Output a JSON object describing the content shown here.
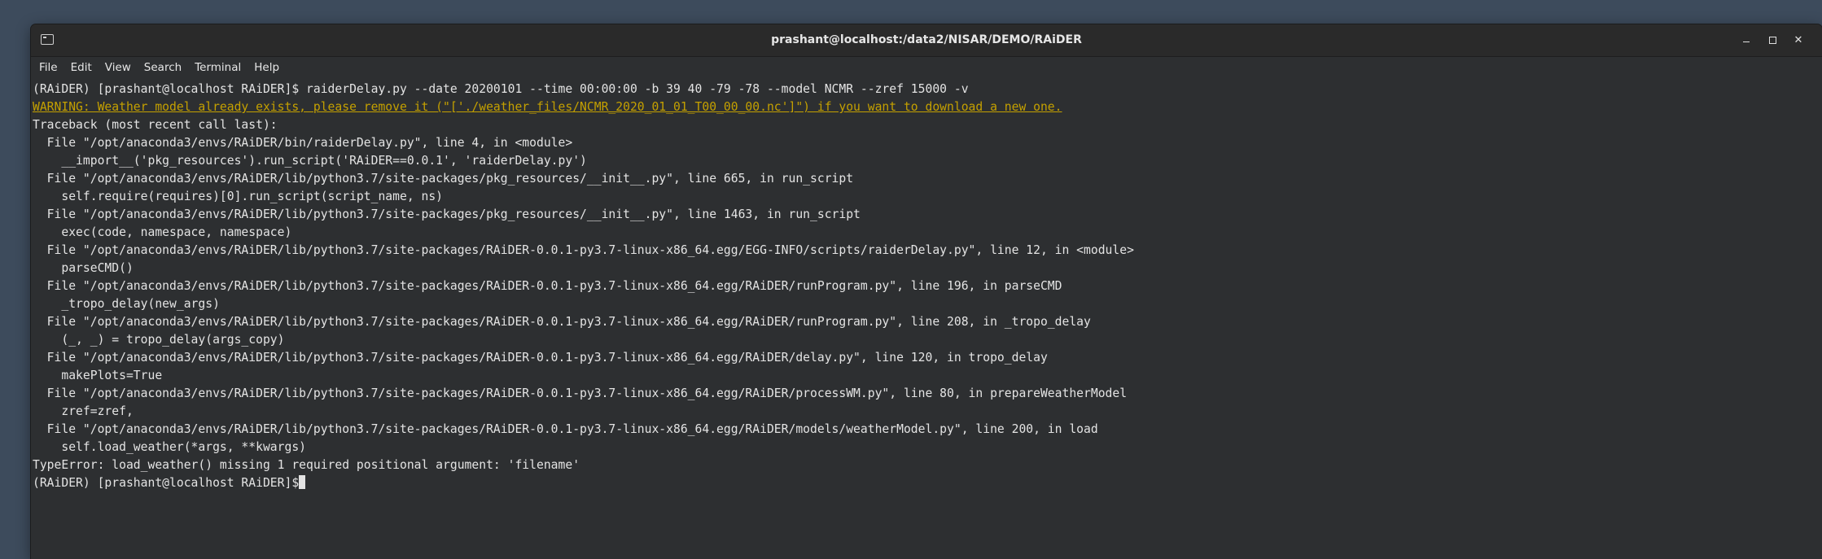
{
  "window": {
    "title": "prashant@localhost:/data2/NISAR/DEMO/RAiDER"
  },
  "window_controls": [
    "minimize",
    "maximize",
    "close"
  ],
  "menubar": {
    "items": [
      "File",
      "Edit",
      "View",
      "Search",
      "Terminal",
      "Help"
    ]
  },
  "terminal": {
    "lines": [
      "(RAiDER) [prashant@localhost RAiDER]$ raiderDelay.py --date 20200101 --time 00:00:00 -b 39 40 -79 -78 --model NCMR --zref 15000 -v",
      "WARNING: Weather model already exists, please remove it (\"['./weather_files/NCMR_2020_01_01_T00_00_00.nc']\") if you want to download a new one.",
      "Traceback (most recent call last):",
      "  File \"/opt/anaconda3/envs/RAiDER/bin/raiderDelay.py\", line 4, in <module>",
      "    __import__('pkg_resources').run_script('RAiDER==0.0.1', 'raiderDelay.py')",
      "  File \"/opt/anaconda3/envs/RAiDER/lib/python3.7/site-packages/pkg_resources/__init__.py\", line 665, in run_script",
      "    self.require(requires)[0].run_script(script_name, ns)",
      "  File \"/opt/anaconda3/envs/RAiDER/lib/python3.7/site-packages/pkg_resources/__init__.py\", line 1463, in run_script",
      "    exec(code, namespace, namespace)",
      "  File \"/opt/anaconda3/envs/RAiDER/lib/python3.7/site-packages/RAiDER-0.0.1-py3.7-linux-x86_64.egg/EGG-INFO/scripts/raiderDelay.py\", line 12, in <module>",
      "    parseCMD()",
      "  File \"/opt/anaconda3/envs/RAiDER/lib/python3.7/site-packages/RAiDER-0.0.1-py3.7-linux-x86_64.egg/RAiDER/runProgram.py\", line 196, in parseCMD",
      "    _tropo_delay(new_args)",
      "  File \"/opt/anaconda3/envs/RAiDER/lib/python3.7/site-packages/RAiDER-0.0.1-py3.7-linux-x86_64.egg/RAiDER/runProgram.py\", line 208, in _tropo_delay",
      "    (_, _) = tropo_delay(args_copy)",
      "  File \"/opt/anaconda3/envs/RAiDER/lib/python3.7/site-packages/RAiDER-0.0.1-py3.7-linux-x86_64.egg/RAiDER/delay.py\", line 120, in tropo_delay",
      "    makePlots=True",
      "  File \"/opt/anaconda3/envs/RAiDER/lib/python3.7/site-packages/RAiDER-0.0.1-py3.7-linux-x86_64.egg/RAiDER/processWM.py\", line 80, in prepareWeatherModel",
      "    zref=zref,",
      "  File \"/opt/anaconda3/envs/RAiDER/lib/python3.7/site-packages/RAiDER-0.0.1-py3.7-linux-x86_64.egg/RAiDER/models/weatherModel.py\", line 200, in load",
      "    self.load_weather(*args, **kwargs)",
      "TypeError: load_weather() missing 1 required positional argument: 'filename'",
      "(RAiDER) [prashant@localhost RAiDER]$"
    ],
    "warning_line_index": 1,
    "warning_color": "#c4a000"
  }
}
